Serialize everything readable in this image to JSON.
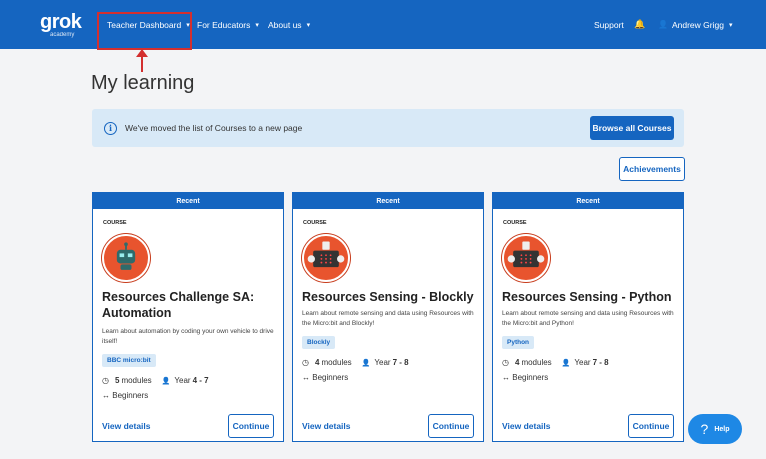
{
  "nav": {
    "logo": "grok",
    "logo_sub": "academy",
    "items": [
      {
        "label": "Teacher Dashboard",
        "caret": "▾"
      },
      {
        "label": "For Educators",
        "caret": "▾"
      },
      {
        "label": "About us",
        "caret": "▾"
      }
    ],
    "support": "Support",
    "bell_icon": "🔔",
    "user_icon": "👤",
    "user": "Andrew Grigg",
    "user_caret": "▾"
  },
  "page_title": "My learning",
  "notice": {
    "icon": "i",
    "text": "We've moved the list of Courses to a new page",
    "button": "Browse all Courses"
  },
  "achievements": "Achievements",
  "cards": [
    {
      "header": "Recent",
      "kind": "COURSE",
      "title": "Resources Challenge SA: Automation",
      "desc": "Learn about automation by coding your own vehicle to drive itself!",
      "tag": "BBC micro:bit",
      "modules_icon": "◷",
      "modules_n": "5",
      "modules_label": "modules",
      "year_icon": "👤",
      "year_label": "Year",
      "year_range": "4 - 7",
      "level_icon": "↔",
      "level": "Beginners",
      "view": "View details",
      "continue": "Continue"
    },
    {
      "header": "Recent",
      "kind": "COURSE",
      "title": "Resources Sensing - Blockly",
      "desc": "Learn about remote sensing and data using Resources with the Micro:bit and Blockly!",
      "tag": "Blockly",
      "modules_icon": "◷",
      "modules_n": "4",
      "modules_label": "modules",
      "year_icon": "👤",
      "year_label": "Year",
      "year_range": "7 - 8",
      "level_icon": "↔",
      "level": "Beginners",
      "view": "View details",
      "continue": "Continue"
    },
    {
      "header": "Recent",
      "kind": "COURSE",
      "title": "Resources Sensing - Python",
      "desc": "Learn about remote sensing and data using Resources with the Micro:bit and Python!",
      "tag": "Python",
      "modules_icon": "◷",
      "modules_n": "4",
      "modules_label": "modules",
      "year_icon": "👤",
      "year_label": "Year",
      "year_range": "7 - 8",
      "level_icon": "↔",
      "level": "Beginners",
      "view": "View details",
      "continue": "Continue"
    }
  ],
  "help": {
    "icon": "?",
    "label": "Help"
  },
  "colors": {
    "brand": "#1565c0",
    "highlight": "#d32f2f",
    "icon_bg": "#e8542e"
  }
}
